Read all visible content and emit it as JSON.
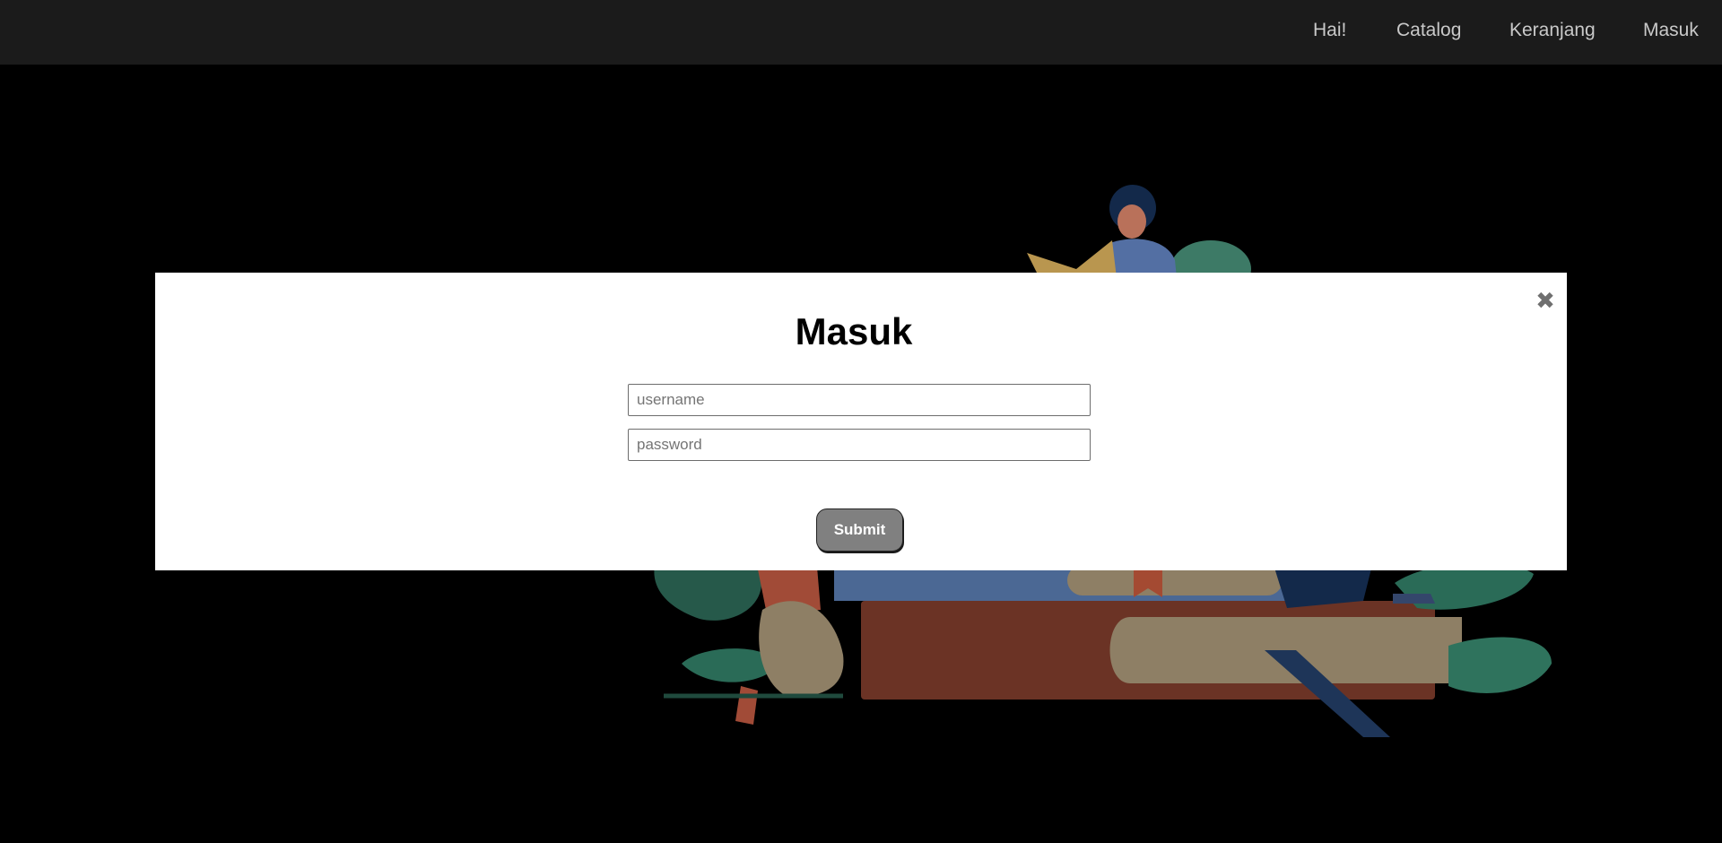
{
  "navbar": {
    "items": [
      {
        "label": "Hai!"
      },
      {
        "label": "Catalog"
      },
      {
        "label": "Keranjang"
      },
      {
        "label": "Masuk"
      }
    ]
  },
  "modal": {
    "title": "Masuk",
    "close_icon": "close-icon",
    "username_placeholder": "username",
    "password_placeholder": "password",
    "submit_label": "Submit"
  },
  "colors": {
    "navbar_bg": "#1b1b1b",
    "page_bg": "#000000",
    "nav_text": "#c9c9c9",
    "submit_bg": "#808080"
  }
}
